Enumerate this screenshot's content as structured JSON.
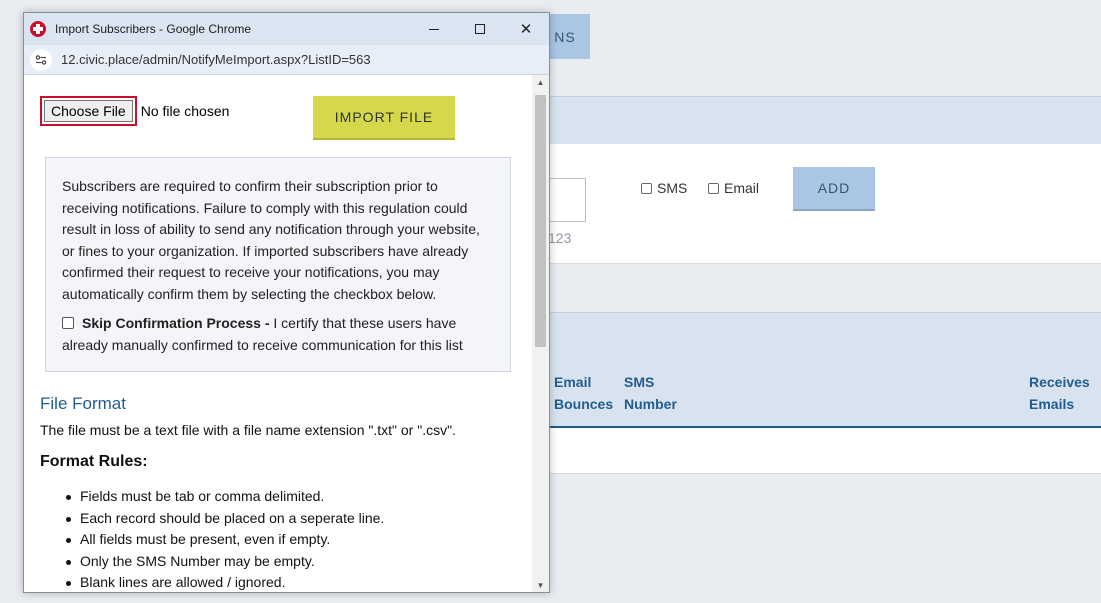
{
  "background": {
    "top_button_label": "NS",
    "hint_text": "123",
    "sms_label": "SMS",
    "email_label": "Email",
    "add_label": "ADD",
    "columns": [
      {
        "line1": "Email",
        "line2": "Bounces"
      },
      {
        "line1": "SMS",
        "line2": "Number"
      },
      {
        "line1": "Receives",
        "line2": "Emails"
      }
    ]
  },
  "window": {
    "title": "Import Subscribers - Google Chrome",
    "url": "12.civic.place/admin/NotifyMeImport.aspx?ListID=563",
    "minimize_glyph": "",
    "close_glyph": "✕"
  },
  "form": {
    "choose_file_label": "Choose File",
    "no_file_text": "No file chosen",
    "import_label": "IMPORT FILE"
  },
  "notice": {
    "text": "Subscribers are required to confirm their subscription prior to receiving notifications. Failure to comply with this regulation could result in loss of ability to send any notification through your website, or fines to your organization. If imported subscribers have already confirmed their request to receive your notifications, you may automatically confirm them by selecting the checkbox below.",
    "skip_label": "Skip Confirmation Process -",
    "skip_desc": " I certify that these users have already manually confirmed to receive communication for this list"
  },
  "file_format": {
    "title": "File Format",
    "description": "The file must be a text file with a file name extension \".txt\" or \".csv\".",
    "rules_title": "Format Rules:",
    "rules": [
      "Fields must be tab or comma delimited.",
      "Each record should be placed on a seperate line.",
      "All fields must be present, even if empty.",
      "Only the SMS Number may be empty.",
      "Blank lines are allowed / ignored."
    ]
  },
  "icons": {
    "app": "civicplus-logo-icon",
    "site_info": "site-settings-icon",
    "scroll_up": "▲",
    "scroll_down": "▼"
  },
  "colors": {
    "accent_blue": "#225d90",
    "import_button": "#d6d84b",
    "highlight_red": "#c8102e",
    "titlebar": "#dbe4f1"
  }
}
